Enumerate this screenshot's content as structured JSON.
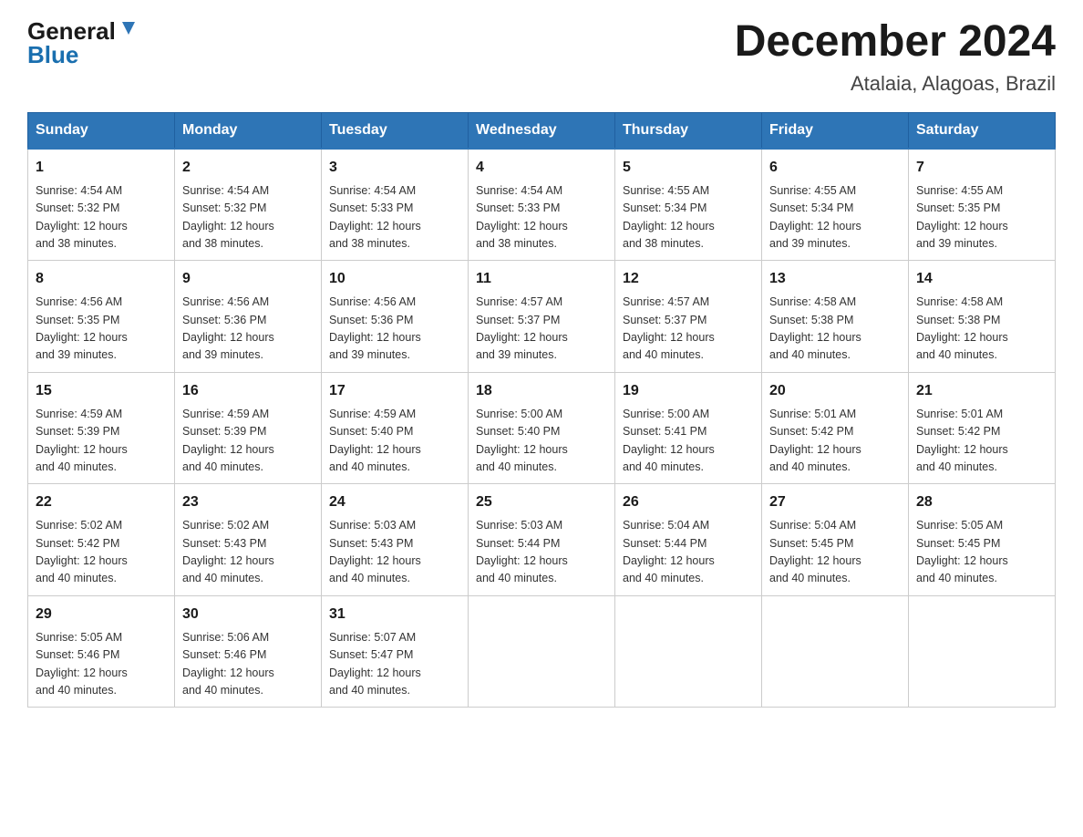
{
  "logo": {
    "general": "General",
    "blue": "Blue",
    "arrow": "▶"
  },
  "title": {
    "month": "December 2024",
    "location": "Atalaia, Alagoas, Brazil"
  },
  "weekdays": [
    "Sunday",
    "Monday",
    "Tuesday",
    "Wednesday",
    "Thursday",
    "Friday",
    "Saturday"
  ],
  "weeks": [
    [
      {
        "day": "1",
        "sunrise": "4:54 AM",
        "sunset": "5:32 PM",
        "daylight": "12 hours and 38 minutes."
      },
      {
        "day": "2",
        "sunrise": "4:54 AM",
        "sunset": "5:32 PM",
        "daylight": "12 hours and 38 minutes."
      },
      {
        "day": "3",
        "sunrise": "4:54 AM",
        "sunset": "5:33 PM",
        "daylight": "12 hours and 38 minutes."
      },
      {
        "day": "4",
        "sunrise": "4:54 AM",
        "sunset": "5:33 PM",
        "daylight": "12 hours and 38 minutes."
      },
      {
        "day": "5",
        "sunrise": "4:55 AM",
        "sunset": "5:34 PM",
        "daylight": "12 hours and 38 minutes."
      },
      {
        "day": "6",
        "sunrise": "4:55 AM",
        "sunset": "5:34 PM",
        "daylight": "12 hours and 39 minutes."
      },
      {
        "day": "7",
        "sunrise": "4:55 AM",
        "sunset": "5:35 PM",
        "daylight": "12 hours and 39 minutes."
      }
    ],
    [
      {
        "day": "8",
        "sunrise": "4:56 AM",
        "sunset": "5:35 PM",
        "daylight": "12 hours and 39 minutes."
      },
      {
        "day": "9",
        "sunrise": "4:56 AM",
        "sunset": "5:36 PM",
        "daylight": "12 hours and 39 minutes."
      },
      {
        "day": "10",
        "sunrise": "4:56 AM",
        "sunset": "5:36 PM",
        "daylight": "12 hours and 39 minutes."
      },
      {
        "day": "11",
        "sunrise": "4:57 AM",
        "sunset": "5:37 PM",
        "daylight": "12 hours and 39 minutes."
      },
      {
        "day": "12",
        "sunrise": "4:57 AM",
        "sunset": "5:37 PM",
        "daylight": "12 hours and 40 minutes."
      },
      {
        "day": "13",
        "sunrise": "4:58 AM",
        "sunset": "5:38 PM",
        "daylight": "12 hours and 40 minutes."
      },
      {
        "day": "14",
        "sunrise": "4:58 AM",
        "sunset": "5:38 PM",
        "daylight": "12 hours and 40 minutes."
      }
    ],
    [
      {
        "day": "15",
        "sunrise": "4:59 AM",
        "sunset": "5:39 PM",
        "daylight": "12 hours and 40 minutes."
      },
      {
        "day": "16",
        "sunrise": "4:59 AM",
        "sunset": "5:39 PM",
        "daylight": "12 hours and 40 minutes."
      },
      {
        "day": "17",
        "sunrise": "4:59 AM",
        "sunset": "5:40 PM",
        "daylight": "12 hours and 40 minutes."
      },
      {
        "day": "18",
        "sunrise": "5:00 AM",
        "sunset": "5:40 PM",
        "daylight": "12 hours and 40 minutes."
      },
      {
        "day": "19",
        "sunrise": "5:00 AM",
        "sunset": "5:41 PM",
        "daylight": "12 hours and 40 minutes."
      },
      {
        "day": "20",
        "sunrise": "5:01 AM",
        "sunset": "5:42 PM",
        "daylight": "12 hours and 40 minutes."
      },
      {
        "day": "21",
        "sunrise": "5:01 AM",
        "sunset": "5:42 PM",
        "daylight": "12 hours and 40 minutes."
      }
    ],
    [
      {
        "day": "22",
        "sunrise": "5:02 AM",
        "sunset": "5:42 PM",
        "daylight": "12 hours and 40 minutes."
      },
      {
        "day": "23",
        "sunrise": "5:02 AM",
        "sunset": "5:43 PM",
        "daylight": "12 hours and 40 minutes."
      },
      {
        "day": "24",
        "sunrise": "5:03 AM",
        "sunset": "5:43 PM",
        "daylight": "12 hours and 40 minutes."
      },
      {
        "day": "25",
        "sunrise": "5:03 AM",
        "sunset": "5:44 PM",
        "daylight": "12 hours and 40 minutes."
      },
      {
        "day": "26",
        "sunrise": "5:04 AM",
        "sunset": "5:44 PM",
        "daylight": "12 hours and 40 minutes."
      },
      {
        "day": "27",
        "sunrise": "5:04 AM",
        "sunset": "5:45 PM",
        "daylight": "12 hours and 40 minutes."
      },
      {
        "day": "28",
        "sunrise": "5:05 AM",
        "sunset": "5:45 PM",
        "daylight": "12 hours and 40 minutes."
      }
    ],
    [
      {
        "day": "29",
        "sunrise": "5:05 AM",
        "sunset": "5:46 PM",
        "daylight": "12 hours and 40 minutes."
      },
      {
        "day": "30",
        "sunrise": "5:06 AM",
        "sunset": "5:46 PM",
        "daylight": "12 hours and 40 minutes."
      },
      {
        "day": "31",
        "sunrise": "5:07 AM",
        "sunset": "5:47 PM",
        "daylight": "12 hours and 40 minutes."
      },
      null,
      null,
      null,
      null
    ]
  ],
  "labels": {
    "sunrise": "Sunrise:",
    "sunset": "Sunset:",
    "daylight": "Daylight:"
  },
  "colors": {
    "header_bg": "#2e75b6",
    "header_text": "#ffffff",
    "border": "#2e75b6"
  }
}
